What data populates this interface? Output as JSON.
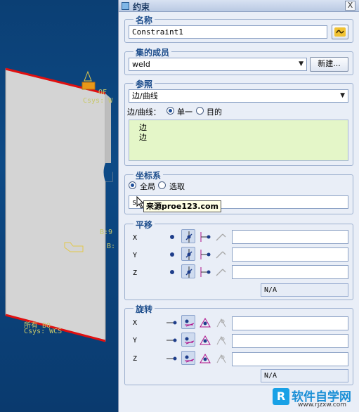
{
  "viewport": {
    "labels": {
      "top_marker": "OF",
      "top_csys": "Csys: W",
      "mid": "B:9",
      "mid2": "B:",
      "bottom_name": "所有 BO",
      "bottom_csys": "Csys: WCS"
    }
  },
  "dialog": {
    "title": "约束",
    "close_label": "X",
    "name": {
      "legend": "名称",
      "value": "Constraint1"
    },
    "member_set": {
      "legend": "集的成员",
      "value": "weld",
      "new_button": "新建..."
    },
    "references": {
      "legend": "参照",
      "type_value": "边/曲线",
      "mode_label": "边/曲线：",
      "option_single": "单一",
      "option_target": "目的",
      "items": [
        "边",
        "边"
      ]
    },
    "csys": {
      "legend": "坐标系",
      "option_global": "全局",
      "option_select": "选取",
      "field_value": "s"
    },
    "translation": {
      "legend": "平移",
      "axes": [
        "X",
        "Y",
        "Z"
      ],
      "status": "N/A"
    },
    "rotation": {
      "legend": "旋转",
      "axes": [
        "X",
        "Y",
        "Z"
      ],
      "status": "N/A"
    }
  },
  "tooltip": "来源proe123.com",
  "watermark": {
    "logo": "R",
    "name": "软件自学网",
    "url": "www.rjzxw.com"
  }
}
